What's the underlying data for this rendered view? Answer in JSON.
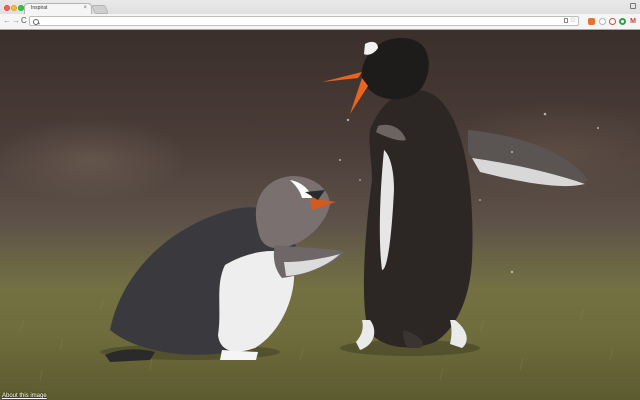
{
  "browser": {
    "tab": {
      "title": "Inspirat",
      "close_glyph": "×"
    },
    "toolbar": {
      "back_glyph": "←",
      "forward_glyph": "→",
      "reload_glyph": "C",
      "omnibox_value": "",
      "star_glyph": "☆"
    },
    "extensions": [
      "extension-orange-icon",
      "extension-circle-icon",
      "extension-power-icon",
      "extension-green-ring-icon",
      "gmail-icon"
    ],
    "gmail_glyph": "M",
    "colors": {
      "traffic_red": "#fc5f57",
      "traffic_yellow": "#fdbc2e",
      "traffic_green": "#29c940"
    }
  },
  "page": {
    "photo_subject": "two-gentoo-penguins-fighting-on-grass",
    "about_link": "About this image"
  }
}
